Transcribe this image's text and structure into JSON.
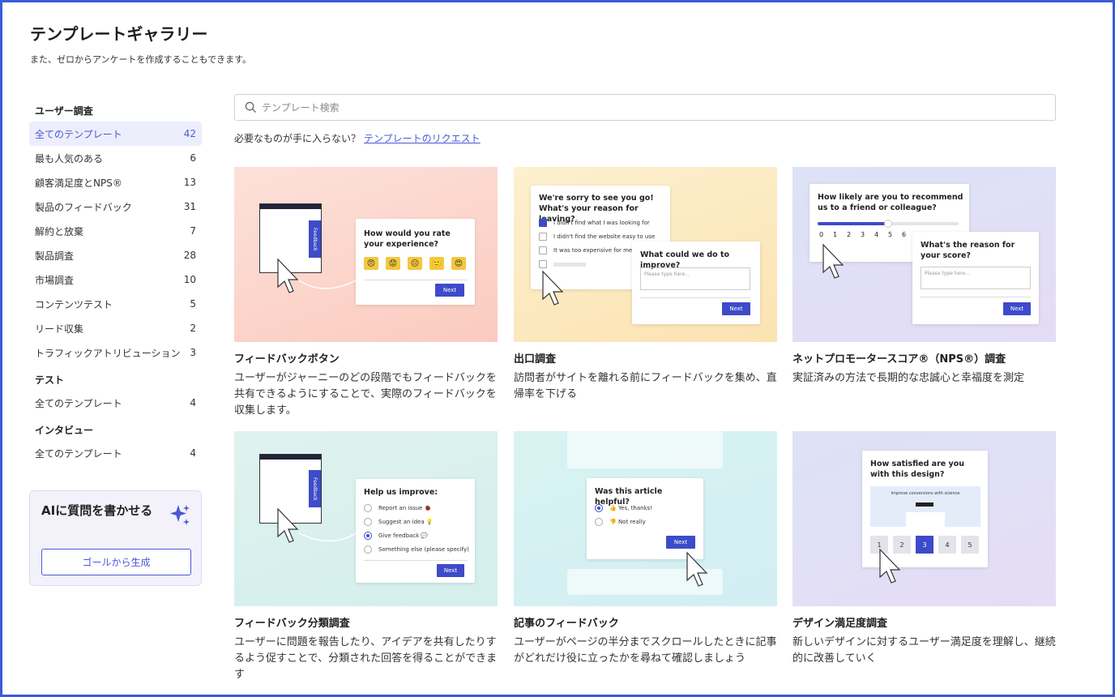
{
  "header": {
    "title": "テンプレートギャラリー",
    "subtitle": "また、ゼロからアンケートを作成することもできます。"
  },
  "sidebar": {
    "sections": [
      {
        "title": "ユーザー調査",
        "items": [
          {
            "label": "全てのテンプレート",
            "count": "42",
            "active": true
          },
          {
            "label": "最も人気のある",
            "count": "6"
          },
          {
            "label": "顧客満足度とNPS®",
            "count": "13"
          },
          {
            "label": "製品のフィードバック",
            "count": "31"
          },
          {
            "label": "解約と放棄",
            "count": "7"
          },
          {
            "label": "製品調査",
            "count": "28"
          },
          {
            "label": "市場調査",
            "count": "10"
          },
          {
            "label": "コンテンツテスト",
            "count": "5"
          },
          {
            "label": "リード収集",
            "count": "2"
          },
          {
            "label": "トラフィックアトリビューション",
            "count": "3"
          }
        ]
      },
      {
        "title": "テスト",
        "items": [
          {
            "label": "全てのテンプレート",
            "count": "4"
          }
        ]
      },
      {
        "title": "インタビュー",
        "items": [
          {
            "label": "全てのテンプレート",
            "count": "4"
          }
        ]
      }
    ],
    "ai": {
      "title": "AIに質問を書かせる",
      "button": "ゴールから生成",
      "icon": "sparkle-icon"
    }
  },
  "search": {
    "placeholder": "テンプレート検索",
    "icon": "search-icon"
  },
  "request": {
    "text": "必要なものが手に入らない？",
    "link": "テンプレートのリクエスト"
  },
  "colors": {
    "accent": "#4a58d6",
    "button": "#3d4bc9",
    "active_bg": "#eceefc"
  },
  "cards": [
    {
      "title": "フィードバックボタン",
      "desc": "ユーザーがジャーニーのどの段階でもフィードバックを共有できるようにすることで、実際のフィードバックを収集します。",
      "mock": {
        "tab": "Feedback",
        "question": "How would you rate your experience?",
        "emojis": [
          "😠",
          "😟",
          "😐",
          "🙂",
          "😍"
        ],
        "next": "Next"
      }
    },
    {
      "title": "出口調査",
      "desc": "訪問者がサイトを離れる前にフィードバックを集め、直帰率を下げる",
      "mock": {
        "question": "We're sorry to see you go! What's your reason for leaving?",
        "options": [
          "I didn't find what I was looking for",
          "I didn't find the website easy to use",
          "It was too expensive for me"
        ],
        "question2": "What could we do to improve?",
        "placeholder": "Please type here...",
        "next": "Next"
      }
    },
    {
      "title": "ネットプロモータースコア®（NPS®）調査",
      "desc": "実証済みの方法で長期的な忠誠心と幸福度を測定",
      "mock": {
        "question": "How likely are you to recommend us to a friend or colleague?",
        "scale": [
          "0",
          "1",
          "2",
          "3",
          "4",
          "5",
          "6"
        ],
        "question2": "What's the reason for your score?",
        "placeholder": "Please type here...",
        "next": "Next"
      }
    },
    {
      "title": "フィードバック分類調査",
      "desc": "ユーザーに問題を報告したり、アイデアを共有したりするよう促すことで、分類された回答を得ることができます",
      "mock": {
        "tab": "Feedback",
        "question": "Help us improve:",
        "options": [
          "Report an issue 🐞",
          "Suggest an idea 💡",
          "Give feedback 💬",
          "Something else (please specify)"
        ],
        "next": "Next"
      }
    },
    {
      "title": "記事のフィードバック",
      "desc": "ユーザーがページの半分までスクロールしたときに記事がどれだけ役に立ったかを尋ねて確認しましょう",
      "mock": {
        "question": "Was this article helpful?",
        "options": [
          "👍 Yes, thanks!",
          "👎 Not really"
        ],
        "next": "Next"
      }
    },
    {
      "title": "デザイン満足度調査",
      "desc": "新しいデザインに対するユーザー満足度を理解し、継続的に改善していく",
      "mock": {
        "question": "How satisfied are you with this design?",
        "banner": "Improve conversions with science",
        "scale": [
          "1",
          "2",
          "3",
          "4",
          "5"
        ]
      }
    }
  ]
}
